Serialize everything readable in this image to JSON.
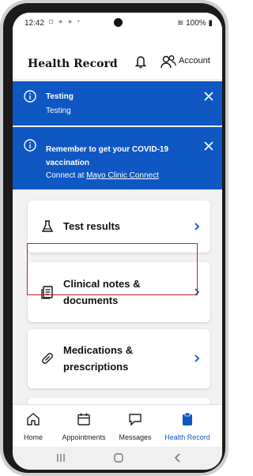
{
  "status_bar": {
    "time": "12:42",
    "battery": "100%"
  },
  "header": {
    "title": "Health Record",
    "account_label": "Account"
  },
  "banners": [
    {
      "title": "Testing",
      "subtitle": "Testing"
    },
    {
      "title": "Remember to get your COVID-19 vaccination",
      "subtitle_prefix": "Connect at ",
      "subtitle_link": "Mayo Clinic Connect"
    }
  ],
  "cards": [
    {
      "label": "Test results",
      "icon": "flask-icon"
    },
    {
      "label": "Clinical notes & documents",
      "icon": "document-icon"
    },
    {
      "label": "Medications & prescriptions",
      "icon": "pill-icon"
    }
  ],
  "tabs": [
    {
      "label": "Home",
      "icon": "home-icon",
      "active": false
    },
    {
      "label": "Appointments",
      "icon": "calendar-icon",
      "active": false
    },
    {
      "label": "Messages",
      "icon": "message-icon",
      "active": false
    },
    {
      "label": "Health Record",
      "icon": "clipboard-icon",
      "active": true
    }
  ],
  "colors": {
    "brand_blue": "#0f57c3",
    "highlight_red": "#c8202d"
  }
}
